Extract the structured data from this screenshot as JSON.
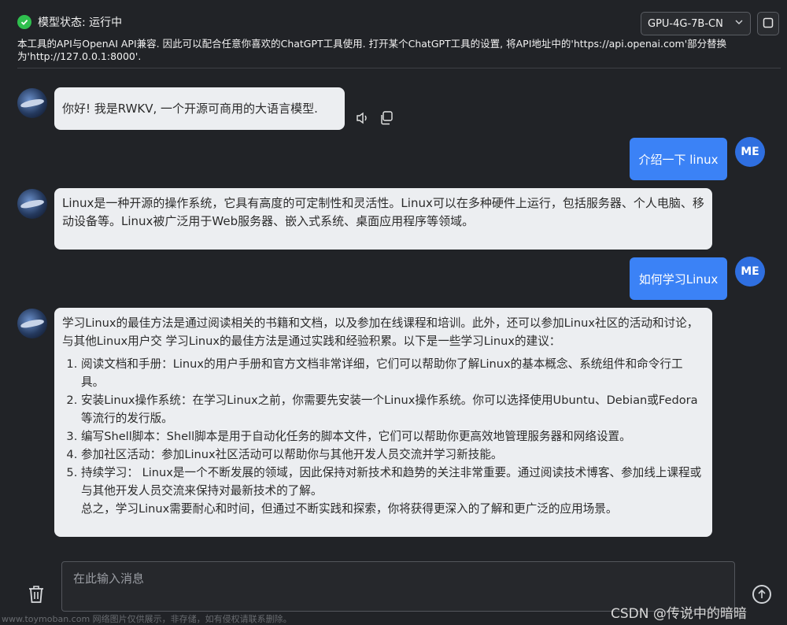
{
  "header": {
    "status_text": "模型状态: 运行中",
    "model_selected": "GPU-4G-7B-CN",
    "info": "本工具的API与OpenAI API兼容. 因此可以配合任意你喜欢的ChatGPT工具使用. 打开某个ChatGPT工具的设置, 将API地址中的'https://api.openai.com'部分替换为'http://127.0.0.1:8000'."
  },
  "messages": {
    "m1": "你好! 我是RWKV, 一个开源可商用的大语言模型.",
    "m2": "介绍一下 linux",
    "m3": "Linux是一种开源的操作系统，它具有高度的可定制性和灵活性。Linux可以在多种硬件上运行，包括服务器、个人电脑、移动设备等。Linux被广泛用于Web服务器、嵌入式系统、桌面应用程序等领域。",
    "m4": "如何学习Linux",
    "m5_intro": "学习Linux的最佳方法是通过阅读相关的书籍和文档，以及参加在线课程和培训。此外，还可以参加Linux社区的活动和讨论，与其他Linux用户交 学习Linux的最佳方法是通过实践和经验积累。以下是一些学习Linux的建议：",
    "m5_steps": [
      "阅读文档和手册：Linux的用户手册和官方文档非常详细，它们可以帮助你了解Linux的基本概念、系统组件和命令行工具。",
      "安装Linux操作系统：在学习Linux之前，你需要先安装一个Linux操作系统。你可以选择使用Ubuntu、Debian或Fedora等流行的发行版。",
      "编写Shell脚本：Shell脚本是用于自动化任务的脚本文件，它们可以帮助你更高效地管理服务器和网络设置。",
      "参加社区活动：参加Linux社区活动可以帮助你与其他开发人员交流并学习新技能。",
      "持续学习： Linux是一个不断发展的领域，因此保持对新技术和趋势的关注非常重要。通过阅读技术博客、参加线上课程或与其他开发人员交流来保持对最新技术的了解。"
    ],
    "m5_summary": "总之，学习Linux需要耐心和时间，但通过不断实践和探索，你将获得更深入的了解和更广泛的应用场景。"
  },
  "avatar": {
    "me_label": "ME"
  },
  "composer": {
    "placeholder": "在此输入消息"
  },
  "watermarks": {
    "left": "www.toymoban.com 网络图片仅供展示，非存储，如有侵权请联系删除。",
    "right": "CSDN @传说中的暗暗"
  },
  "colors": {
    "accent": "#3b82f6",
    "status_ok": "#2fbf4e"
  }
}
